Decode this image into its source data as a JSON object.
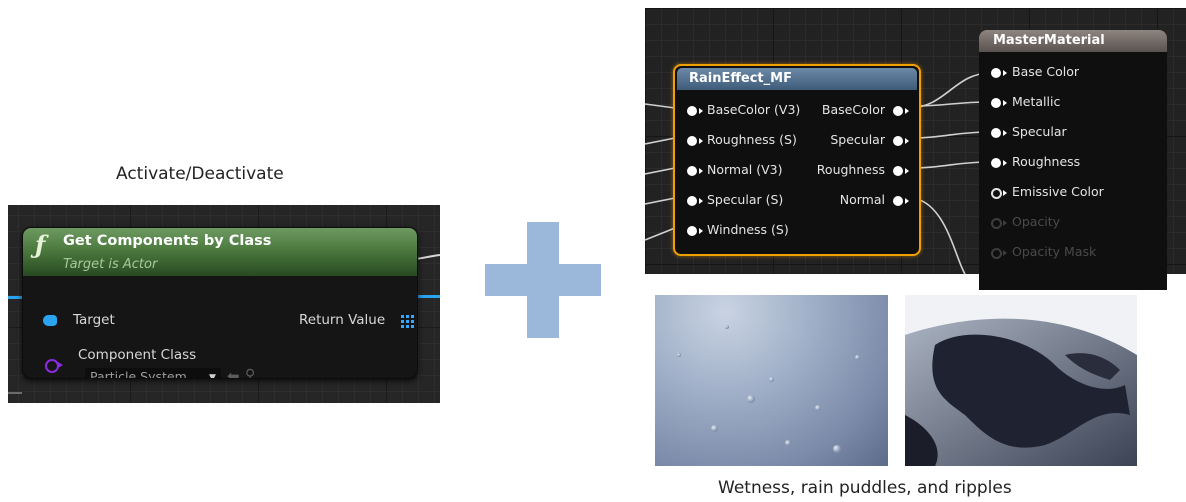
{
  "captions": {
    "left": "Activate/Deactivate",
    "bottom": "Wetness, rain puddles, and ripples"
  },
  "blueprint_node": {
    "icon": "function-icon",
    "title": "Get Components by Class",
    "subtitle": "Target is Actor",
    "inputs": {
      "target": "Target",
      "component_class": "Component Class",
      "component_class_value": "Particle System"
    },
    "outputs": {
      "return_value": "Return Value"
    },
    "colors": {
      "header": "#4c7a3e",
      "exec_pin": "#2aa3f0",
      "class_pin": "#8a2be2"
    }
  },
  "plus_color": "#9bb7da",
  "material_function_node": {
    "title": "RainEffect_MF",
    "inputs": [
      "BaseColor (V3)",
      "Roughness (S)",
      "Normal (V3)",
      "Specular (S)",
      "Windness (S)"
    ],
    "outputs": [
      "BaseColor",
      "Specular",
      "Roughness",
      "Normal"
    ],
    "highlight_color": "#f0a000"
  },
  "master_material_node": {
    "title": "MasterMaterial",
    "inputs": [
      "Base Color",
      "Metallic",
      "Specular",
      "Roughness",
      "Emissive Color",
      "Opacity",
      "Opacity Mask"
    ]
  }
}
